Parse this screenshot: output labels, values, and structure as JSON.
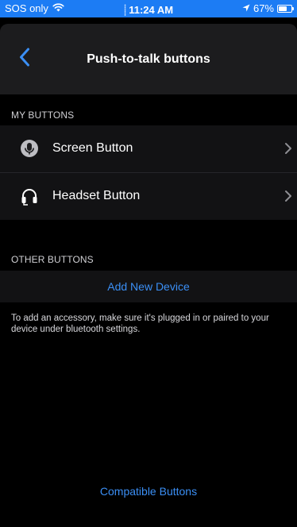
{
  "status_bar": {
    "carrier": "SOS only",
    "time": "11:24 AM",
    "battery": "67%",
    "battery_level": 0.67,
    "wifi_icon": "wifi-icon",
    "location_icon": "location-arrow-icon",
    "mic_icon": "microphone-indicator-icon",
    "background_color": "#1c7cf4"
  },
  "nav": {
    "title": "Push-to-talk buttons",
    "back_icon": "chevron-left-icon"
  },
  "my_buttons": {
    "header": "MY BUTTONS",
    "items": [
      {
        "label": "Screen Button",
        "icon": "microphone-icon"
      },
      {
        "label": "Headset Button",
        "icon": "headset-icon"
      }
    ]
  },
  "other_buttons": {
    "header": "OTHER BUTTONS",
    "add_label": "Add New Device",
    "hint": "To add an accessory, make sure it's plugged in or paired to your device under bluetooth settings."
  },
  "footer": {
    "compatible_label": "Compatible Buttons"
  },
  "colors": {
    "accent": "#3b8ff5",
    "background": "#000000",
    "row_background": "#121214",
    "nav_background": "#1c1c1e"
  }
}
